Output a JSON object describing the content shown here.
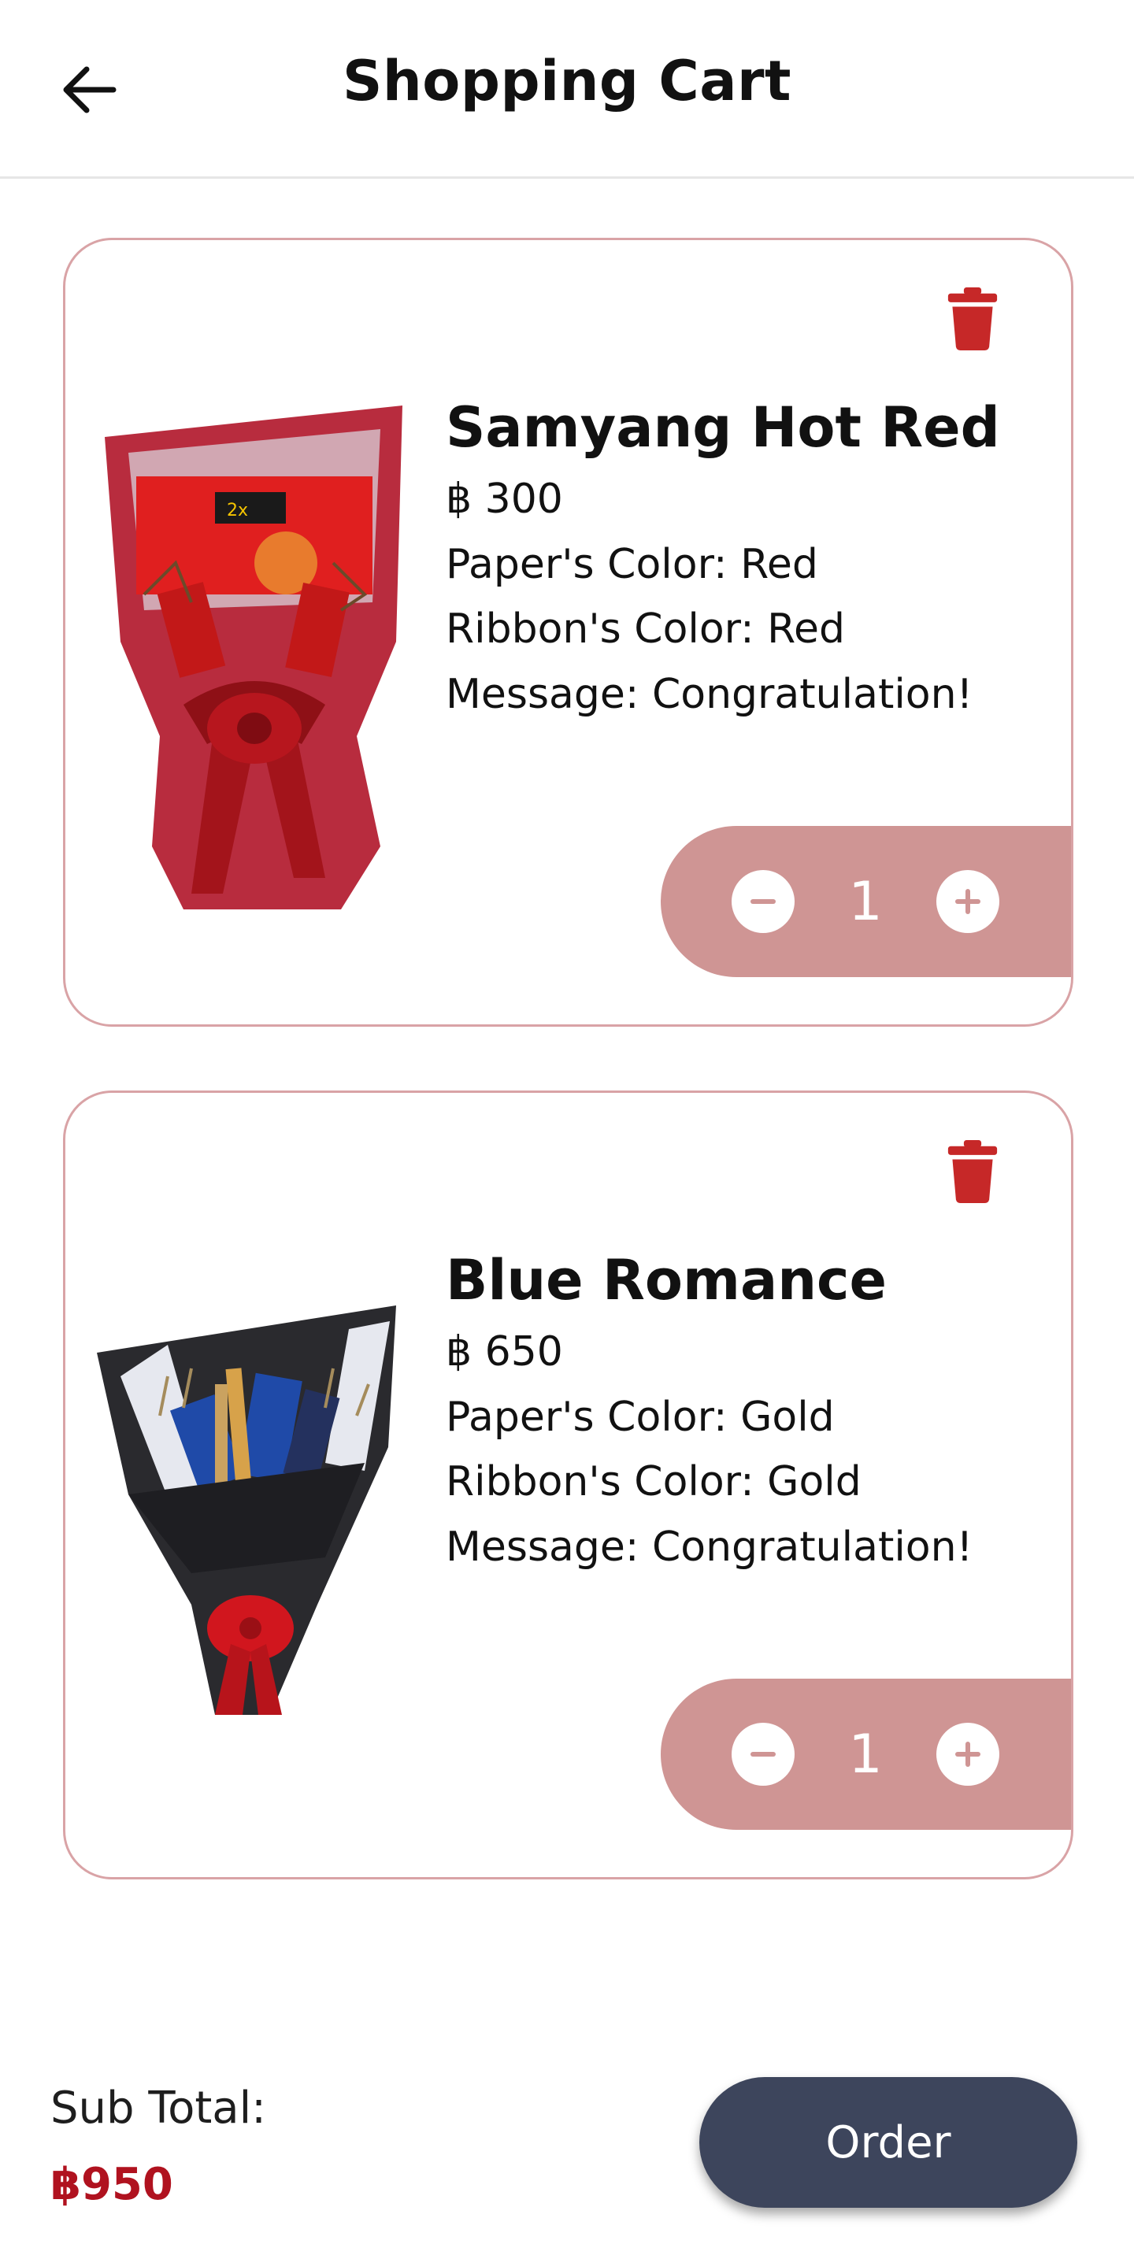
{
  "header": {
    "title": "Shopping Cart"
  },
  "cart": {
    "items": [
      {
        "name": "Samyang Hot Red",
        "price": "฿ 300",
        "paper": "Paper's Color: Red",
        "ribbon": "Ribbon's Color: Red",
        "message": "Message: Congratulation!",
        "quantity": "1"
      },
      {
        "name": "Blue Romance",
        "price": "฿ 650",
        "paper": "Paper's Color: Gold",
        "ribbon": "Ribbon's Color: Gold",
        "message": "Message: Congratulation!",
        "quantity": "1"
      }
    ]
  },
  "footer": {
    "subtotal_label": "Sub Total:",
    "subtotal_value": "฿950",
    "order_label": "Order"
  },
  "colors": {
    "card_border": "#d9a3a6",
    "quantity_bar": "#cf9594",
    "delete_icon": "#c62828",
    "subtotal_value": "#b0121f",
    "order_button": "#3d455c"
  },
  "icons": [
    "back-arrow-icon",
    "trash-icon",
    "minus-icon",
    "plus-icon"
  ]
}
